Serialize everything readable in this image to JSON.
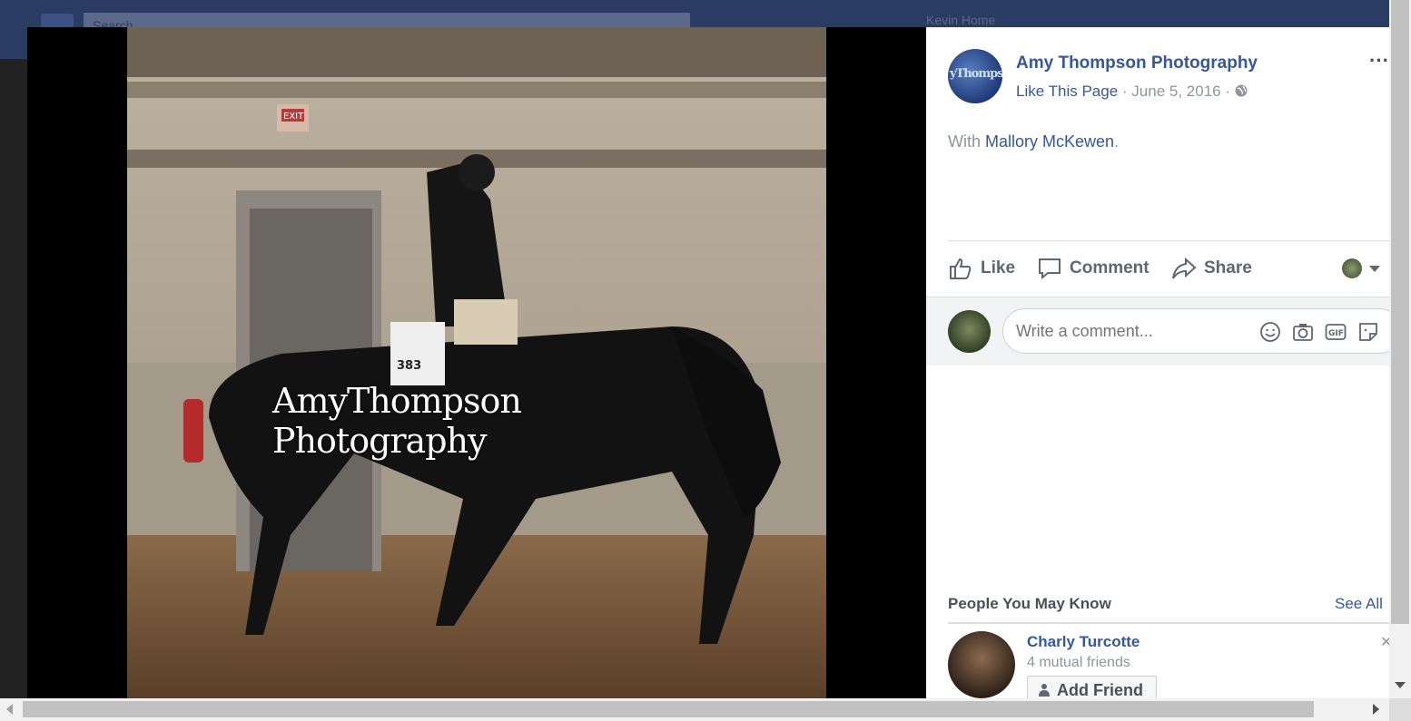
{
  "topbar": {
    "search_placeholder": "Search",
    "user": "Kevin   Home"
  },
  "photo": {
    "watermark": "AmyThompson Photography",
    "saddle_number": "383",
    "exit_sign": "EXIT"
  },
  "post": {
    "page_name": "Amy Thompson Photography",
    "avatar_text": "yThompson",
    "like_page": "Like This Page",
    "date": "June 5, 2016",
    "separator": "·",
    "with_prefix": "With",
    "tagged": "Mallory McKewen",
    "more": "···"
  },
  "actions": {
    "like": "Like",
    "comment": "Comment",
    "share": "Share"
  },
  "comment": {
    "placeholder": "Write a comment..."
  },
  "pymk": {
    "title": "People You May Know",
    "see_all": "See All",
    "friend": {
      "name": "Charly Turcotte",
      "mutual": "4 mutual friends",
      "add_label": "Add Friend"
    }
  },
  "colors": {
    "link": "#365899",
    "muted": "#90949c",
    "topbar": "#2a3c63"
  }
}
